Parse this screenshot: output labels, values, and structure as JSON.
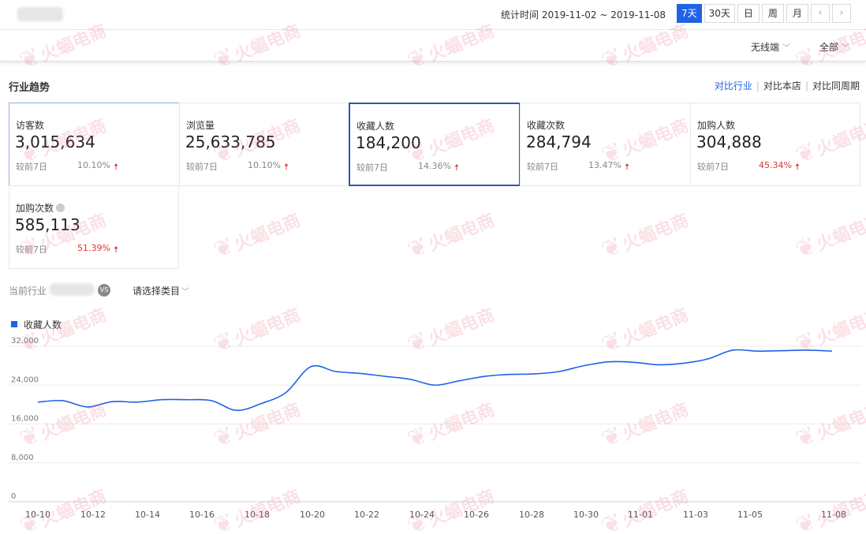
{
  "header": {
    "date_range_label": "统计时间 2019-11-02 ~ 2019-11-08",
    "period_buttons": [
      "7天",
      "30天",
      "日",
      "周",
      "月"
    ],
    "active_period": "7天",
    "prev_icon": "chevron-left-icon",
    "next_icon": "chevron-right-icon"
  },
  "filters": {
    "device": "无线端",
    "scope": "全部"
  },
  "section": {
    "title": "行业趋势",
    "compare_links": [
      "对比行业",
      "对比本店",
      "对比同周期"
    ]
  },
  "metrics": [
    {
      "name": "访客数",
      "value": "3,015,634",
      "compare_label": "较前7日",
      "change": "10.10%",
      "change_trend": "up",
      "highlight": false
    },
    {
      "name": "浏览量",
      "value": "25,633,785",
      "compare_label": "较前7日",
      "change": "10.10%",
      "change_trend": "up",
      "highlight": false
    },
    {
      "name": "收藏人数",
      "value": "184,200",
      "compare_label": "较前7日",
      "change": "14.36%",
      "change_trend": "up",
      "highlight": false
    },
    {
      "name": "收藏次数",
      "value": "284,794",
      "compare_label": "较前7日",
      "change": "13.47%",
      "change_trend": "up",
      "highlight": false
    },
    {
      "name": "加购人数",
      "value": "304,888",
      "compare_label": "较前7日",
      "change": "45.34%",
      "change_trend": "up",
      "highlight": true
    },
    {
      "name": "加购次数",
      "value": "585,113",
      "compare_label": "较前7日",
      "change": "51.39%",
      "change_trend": "up",
      "highlight": true
    }
  ],
  "industry": {
    "label": "当前行业",
    "vs_badge": "VS",
    "category_placeholder": "请选择类目"
  },
  "watermark_text": "火蝠电商",
  "colors": {
    "accent": "#2062e6",
    "up_red": "#e0332d",
    "selected_border": "#2a5aa8"
  },
  "chart_data": {
    "type": "line",
    "series": [
      {
        "name": "收藏人数",
        "color": "#2062e6",
        "values": [
          20500,
          20800,
          19500,
          20600,
          20500,
          21000,
          21000,
          20800,
          18800,
          20200,
          22500,
          27800,
          26800,
          26400,
          25800,
          25200,
          24000,
          24900,
          25800,
          26200,
          26300,
          26800,
          28000,
          28800,
          28700,
          28200,
          28500,
          29400,
          31200,
          31000,
          31100,
          31200,
          31000
        ]
      }
    ],
    "x_ticks": [
      "10-10",
      "10-12",
      "10-14",
      "10-16",
      "10-18",
      "10-20",
      "10-22",
      "10-24",
      "10-26",
      "10-28",
      "10-30",
      "11-01",
      "11-03",
      "11-05",
      "11-08"
    ],
    "y_ticks": [
      "32,000",
      "24,000",
      "16,000",
      "8,000",
      "0"
    ],
    "ylim": [
      0,
      32000
    ],
    "grid": true,
    "legend": "top-left"
  }
}
